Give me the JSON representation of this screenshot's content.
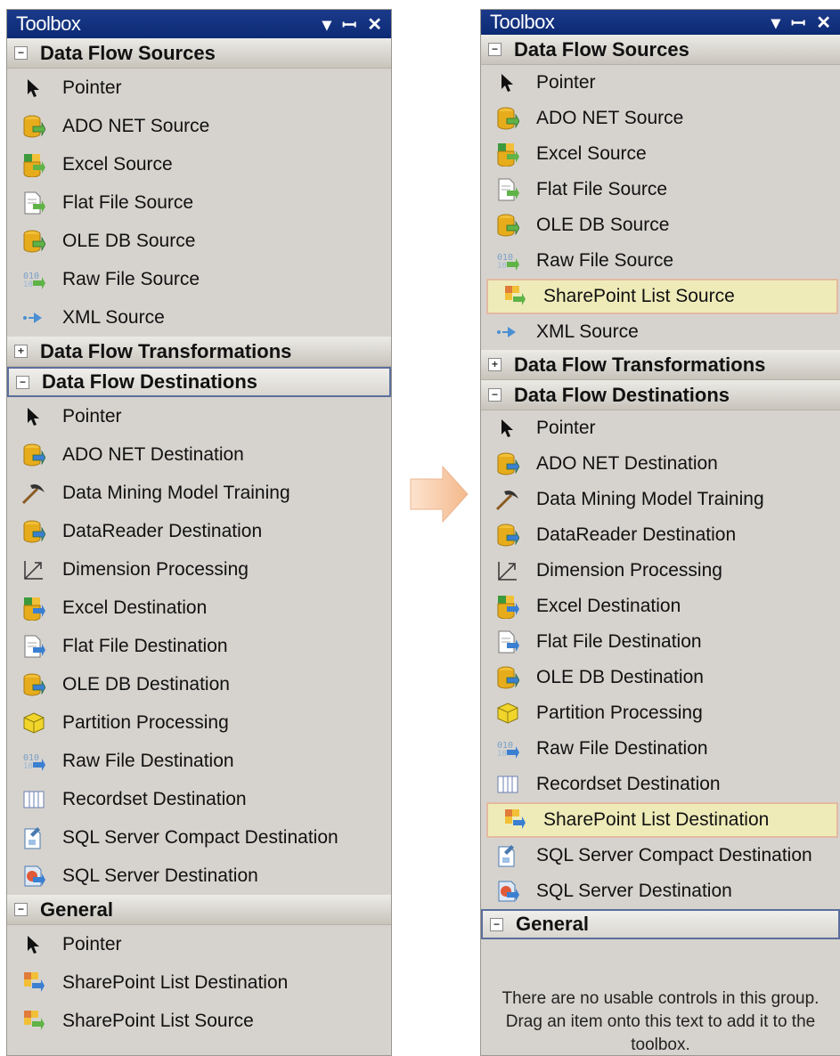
{
  "left": {
    "title": "Toolbox",
    "buttons": [
      "▾",
      "ꟷ",
      "✕"
    ],
    "sections": [
      {
        "header": "Data Flow Sources",
        "expanded": true,
        "selected": false,
        "items": [
          {
            "label": "Pointer",
            "icon": "pointer-icon"
          },
          {
            "label": "ADO NET Source",
            "icon": "ado-net-source-icon"
          },
          {
            "label": "Excel Source",
            "icon": "excel-source-icon"
          },
          {
            "label": "Flat File Source",
            "icon": "flat-file-source-icon"
          },
          {
            "label": "OLE DB Source",
            "icon": "ole-db-source-icon"
          },
          {
            "label": "Raw File Source",
            "icon": "raw-file-source-icon"
          },
          {
            "label": "XML Source",
            "icon": "xml-source-icon"
          }
        ]
      },
      {
        "header": "Data Flow Transformations",
        "expanded": false,
        "selected": false,
        "items": []
      },
      {
        "header": "Data Flow Destinations",
        "expanded": true,
        "selected": true,
        "items": [
          {
            "label": "Pointer",
            "icon": "pointer-icon"
          },
          {
            "label": "ADO NET Destination",
            "icon": "ado-net-destination-icon"
          },
          {
            "label": "Data Mining Model Training",
            "icon": "data-mining-icon"
          },
          {
            "label": "DataReader Destination",
            "icon": "datareader-destination-icon"
          },
          {
            "label": "Dimension Processing",
            "icon": "dimension-processing-icon"
          },
          {
            "label": "Excel Destination",
            "icon": "excel-destination-icon"
          },
          {
            "label": "Flat File Destination",
            "icon": "flat-file-destination-icon"
          },
          {
            "label": "OLE DB Destination",
            "icon": "ole-db-destination-icon"
          },
          {
            "label": "Partition Processing",
            "icon": "partition-processing-icon"
          },
          {
            "label": "Raw File Destination",
            "icon": "raw-file-destination-icon"
          },
          {
            "label": "Recordset Destination",
            "icon": "recordset-destination-icon"
          },
          {
            "label": "SQL Server Compact Destination",
            "icon": "sql-compact-destination-icon"
          },
          {
            "label": "SQL Server Destination",
            "icon": "sql-server-destination-icon"
          }
        ]
      },
      {
        "header": "General",
        "expanded": true,
        "selected": false,
        "items": [
          {
            "label": "Pointer",
            "icon": "pointer-icon"
          },
          {
            "label": "SharePoint List Destination",
            "icon": "sharepoint-destination-icon"
          },
          {
            "label": "SharePoint List Source",
            "icon": "sharepoint-source-icon"
          }
        ]
      }
    ]
  },
  "right": {
    "title": "Toolbox",
    "buttons": [
      "▾",
      "ꟷ",
      "✕"
    ],
    "sections": [
      {
        "header": "Data Flow Sources",
        "expanded": true,
        "selected": false,
        "items": [
          {
            "label": "Pointer",
            "icon": "pointer-icon"
          },
          {
            "label": "ADO NET Source",
            "icon": "ado-net-source-icon"
          },
          {
            "label": "Excel Source",
            "icon": "excel-source-icon"
          },
          {
            "label": "Flat File Source",
            "icon": "flat-file-source-icon"
          },
          {
            "label": "OLE DB Source",
            "icon": "ole-db-source-icon"
          },
          {
            "label": "Raw File Source",
            "icon": "raw-file-source-icon"
          },
          {
            "label": "SharePoint List Source",
            "icon": "sharepoint-source-icon",
            "highlight": true
          },
          {
            "label": "XML Source",
            "icon": "xml-source-icon"
          }
        ]
      },
      {
        "header": "Data Flow Transformations",
        "expanded": false,
        "selected": false,
        "items": []
      },
      {
        "header": "Data Flow Destinations",
        "expanded": true,
        "selected": false,
        "items": [
          {
            "label": "Pointer",
            "icon": "pointer-icon"
          },
          {
            "label": "ADO NET Destination",
            "icon": "ado-net-destination-icon"
          },
          {
            "label": "Data Mining Model Training",
            "icon": "data-mining-icon"
          },
          {
            "label": "DataReader Destination",
            "icon": "datareader-destination-icon"
          },
          {
            "label": "Dimension Processing",
            "icon": "dimension-processing-icon"
          },
          {
            "label": "Excel Destination",
            "icon": "excel-destination-icon"
          },
          {
            "label": "Flat File Destination",
            "icon": "flat-file-destination-icon"
          },
          {
            "label": "OLE DB Destination",
            "icon": "ole-db-destination-icon"
          },
          {
            "label": "Partition Processing",
            "icon": "partition-processing-icon"
          },
          {
            "label": "Raw File Destination",
            "icon": "raw-file-destination-icon"
          },
          {
            "label": "Recordset Destination",
            "icon": "recordset-destination-icon"
          },
          {
            "label": "SharePoint List Destination",
            "icon": "sharepoint-destination-icon",
            "highlight": true
          },
          {
            "label": "SQL Server Compact Destination",
            "icon": "sql-compact-destination-icon"
          },
          {
            "label": "SQL Server Destination",
            "icon": "sql-server-destination-icon"
          }
        ]
      },
      {
        "header": "General",
        "expanded": true,
        "selected": true,
        "items": [],
        "empty_message": "There are no usable controls in this group. Drag an item onto this text to add it to the toolbox."
      }
    ]
  },
  "arrow_icon": "right-arrow-icon",
  "colors": {
    "titlebar": "#0c2a74",
    "panel": "#d6d3ce",
    "highlight": "#eeebb9",
    "arrow": "#f6c7a2"
  }
}
